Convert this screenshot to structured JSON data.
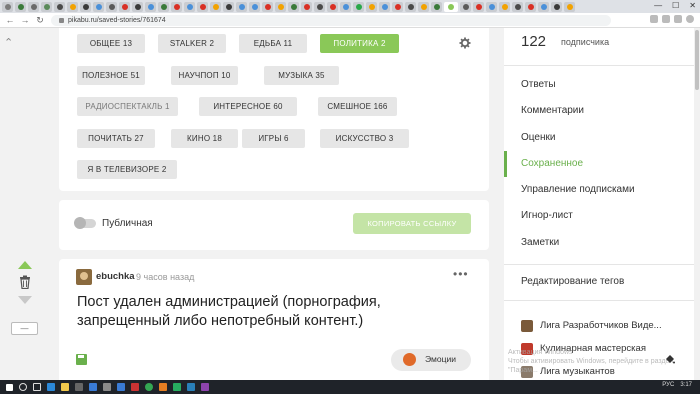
{
  "browser": {
    "url": "pikabu.ru/saved-stories/761674",
    "tab_colors": [
      "#7b7b7b",
      "#3a7a3a",
      "#6a6a6a",
      "#5a8a5a",
      "#4a4a4a",
      "#f2a200",
      "#3a3a3a",
      "#4a90d9",
      "#5a5a5a",
      "#d93025",
      "#3a3a3a",
      "#4a90d9",
      "#3a7a3a",
      "#d93025",
      "#4a90d9",
      "#d93025",
      "#f2a200",
      "#3a3a3a",
      "#4a90d9",
      "#4a90d9",
      "#d93025",
      "#f2a200",
      "#3a7a3a",
      "#d93025",
      "#4a4a4a",
      "#d93025",
      "#4a90d9",
      "#2aa84a",
      "#f2a200",
      "#4a90d9",
      "#d93025",
      "#4a4a4a",
      "#f2a200",
      "#3a7a3a",
      "#8ac858",
      "#5a5a5a",
      "#d93025",
      "#4a90d9",
      "#f2a200",
      "#4a4a4a",
      "#d93025",
      "#4a90d9",
      "#3a3a3a",
      "#f2a200"
    ]
  },
  "tags": [
    {
      "label": "ОБЩЕЕ 13"
    },
    {
      "label": "STALKER 2"
    },
    {
      "label": "ЕДЬБА 11"
    },
    {
      "label": "ПОЛИТИКА 2",
      "active": true
    },
    {
      "label": "ПОЛЕЗНОЕ 51"
    },
    {
      "label": "НАУЧПОП 10"
    },
    {
      "label": "МУЗЫКА 35"
    },
    {
      "label": "РАДИОСПЕКТАКЛЬ 1",
      "dim": true
    },
    {
      "label": "ИНТЕРЕСНОЕ 60"
    },
    {
      "label": "СМЕШНОЕ 166"
    },
    {
      "label": "ПОЧИТАТЬ 27"
    },
    {
      "label": "КИНО 18"
    },
    {
      "label": "ИГРЫ 6"
    },
    {
      "label": "ИСКУССТВО 3"
    },
    {
      "label": "Я В ТЕЛЕВИЗОРЕ 2"
    }
  ],
  "public_toggle": {
    "label": "Публичная",
    "on": false
  },
  "copy_link_label": "КОПИРОВАТЬ ССЫЛКУ",
  "post": {
    "author": "ebuchka",
    "time": "9 часов назад",
    "title": "Пост удален администрацией (порнография, запрещенный либо непотребный контент.)",
    "emotions_label": "Эмоции"
  },
  "left_controls": {
    "minus_label": "—"
  },
  "sidebar": {
    "subscribers_count": "122",
    "subscribers_label": "подписчика",
    "menu": [
      {
        "label": "Ответы"
      },
      {
        "label": "Комментарии"
      },
      {
        "label": "Оценки"
      },
      {
        "label": "Сохраненное",
        "active": true
      },
      {
        "label": "Управление подписками"
      },
      {
        "label": "Игнор-лист"
      },
      {
        "label": "Заметки"
      }
    ],
    "edit_tags_label": "Редактирование тегов",
    "communities": [
      {
        "label": "Лига Разработчиков Виде...",
        "color": "#7a5a3a"
      },
      {
        "label": "Кулинарная мастерская",
        "color": "#c0392b"
      },
      {
        "label": "Лига музыкантов",
        "color": "#8a7a6a"
      }
    ]
  },
  "watermark": {
    "line1": "Активация Windows",
    "line2": "Чтобы активировать Windows, перейдите в раздел \"Парам..."
  },
  "taskbar": {
    "lang": "РУС",
    "clock": "3:17"
  },
  "colors": {
    "accent": "#8ac858",
    "accent_text": "#6ab04c"
  }
}
